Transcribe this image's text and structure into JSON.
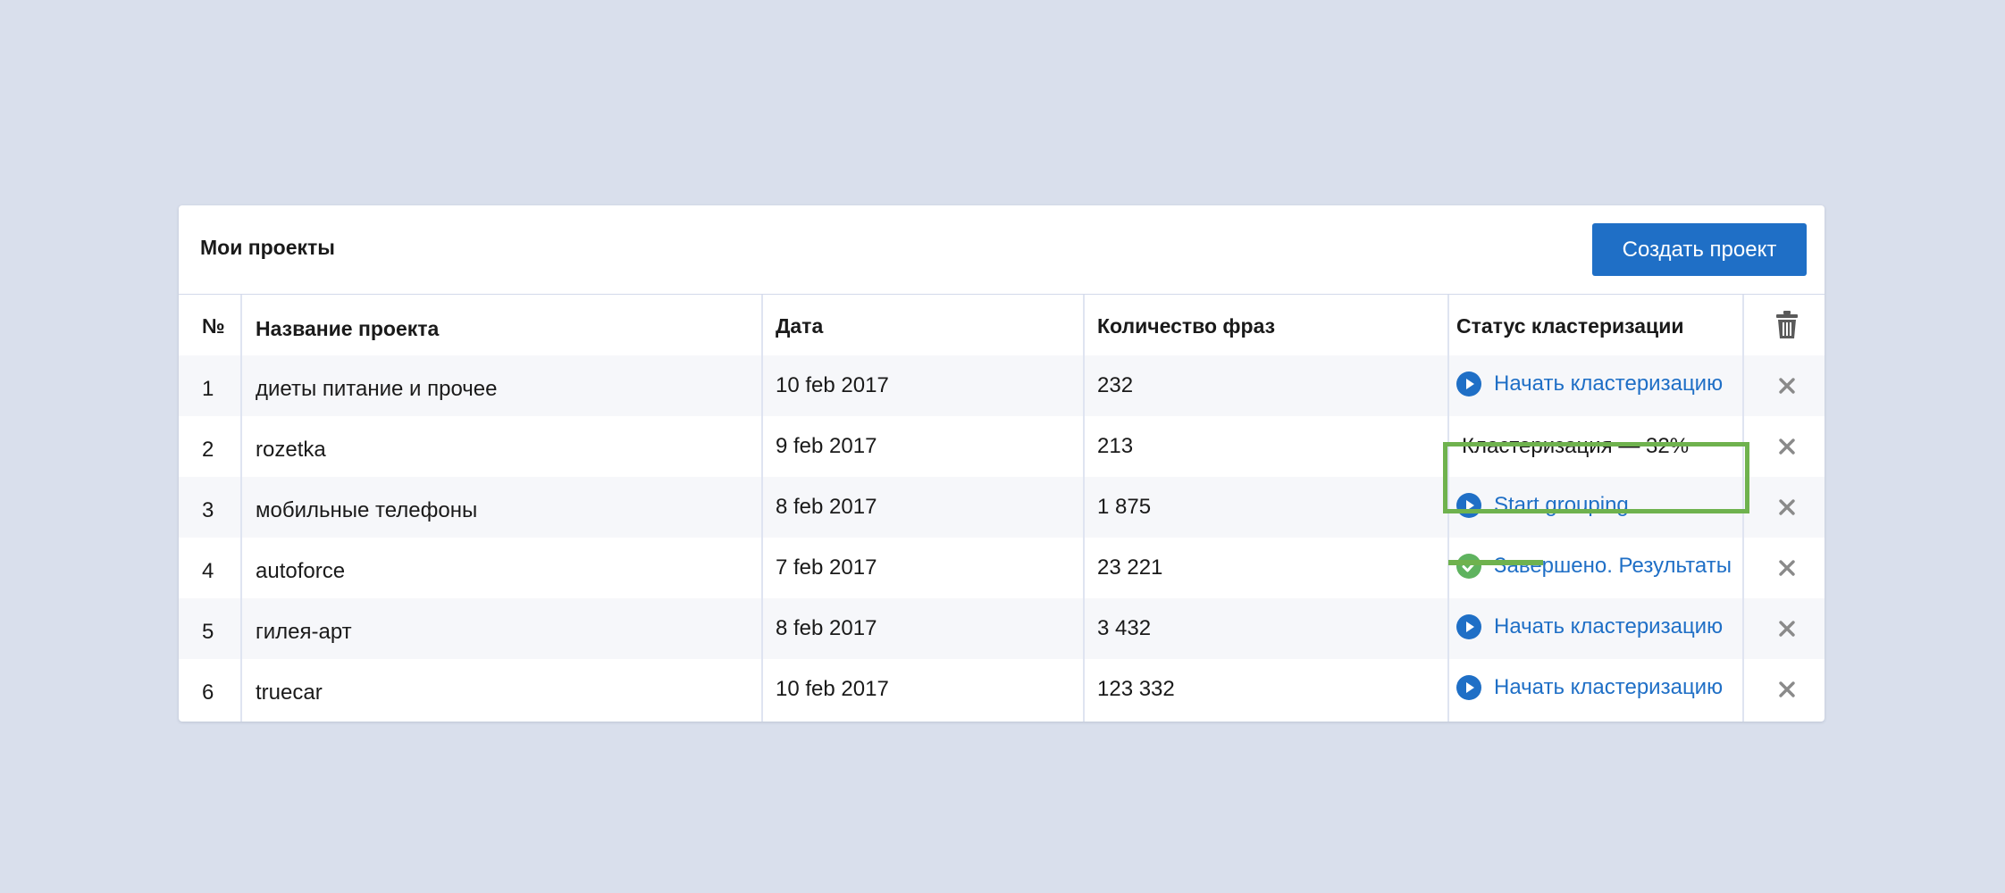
{
  "header": {
    "title": "Мои проекты",
    "create_button": "Создать проект"
  },
  "columns": {
    "num": "№",
    "name": "Название проекта",
    "date": "Дата",
    "phrases": "Количество фраз",
    "status": "Статус кластеризации",
    "delete_icon": "trash-icon"
  },
  "rows": [
    {
      "num": "1",
      "name": "диеты питание и прочее",
      "date": "10 feb 2017",
      "phrases": "232",
      "status_text": "Начать кластеризацию",
      "status_type": "start",
      "status_icon": "play-icon",
      "highlighted": true
    },
    {
      "num": "2",
      "name": "rozetka",
      "date": "9 feb 2017",
      "phrases": "213",
      "status_text": "Кластеризация — 32%",
      "status_type": "progress",
      "progress": 0.32
    },
    {
      "num": "3",
      "name": "мобильные телефоны",
      "date": "8 feb 2017",
      "phrases": "1 875",
      "status_text": "Start grouping",
      "status_type": "start",
      "status_icon": "play-icon"
    },
    {
      "num": "4",
      "name": "autoforce",
      "date": "7  feb 2017",
      "phrases": "23 221",
      "status_text": "Завершено. Результаты",
      "status_type": "done",
      "status_icon": "check-icon"
    },
    {
      "num": "5",
      "name": "гилея-арт",
      "date": "8 feb 2017",
      "phrases": "3 432",
      "status_text": "Начать кластеризацию",
      "status_type": "start",
      "status_icon": "play-icon"
    },
    {
      "num": "6",
      "name": "truecar",
      "date": "10 feb 2017",
      "phrases": "123 332",
      "status_text": "Начать кластеризацию",
      "status_type": "start",
      "status_icon": "play-icon"
    }
  ],
  "colors": {
    "accent": "#1f6fc6",
    "success": "#5fb35f",
    "highlight": "#6fb24e",
    "background": "#d9dfec"
  }
}
